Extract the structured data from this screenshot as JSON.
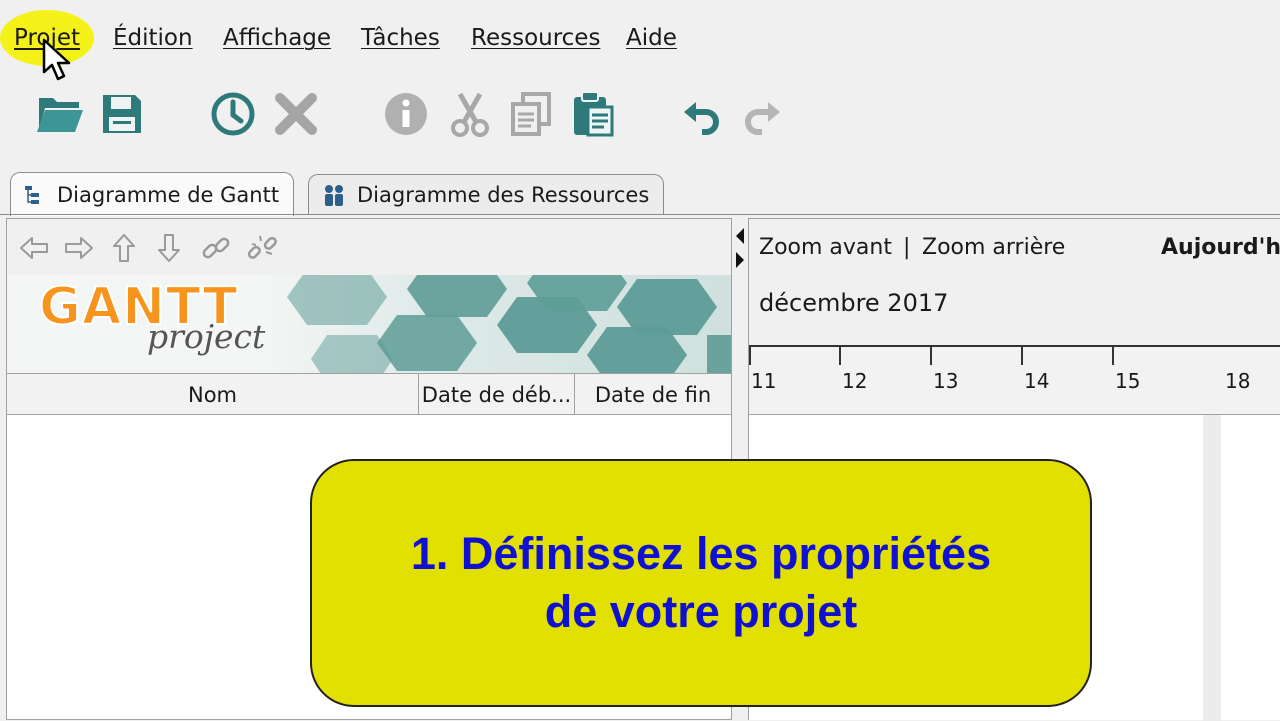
{
  "menu": {
    "items": [
      "Projet",
      "Édition",
      "Affichage",
      "Tâches",
      "Ressources",
      "Aide"
    ],
    "highlight_color": "#f5f21a"
  },
  "toolbar": {
    "icons": [
      "folder-open-icon",
      "save-icon",
      "clock-icon",
      "delete-icon",
      "info-icon",
      "cut-icon",
      "copy-icon",
      "paste-icon",
      "undo-icon",
      "redo-icon"
    ]
  },
  "tabs": {
    "gantt": "Diagramme de Gantt",
    "resources": "Diagramme des Ressources"
  },
  "logo": {
    "word1": "GANTT",
    "word2": "project",
    "color": "#f7941d"
  },
  "table": {
    "columns": [
      "Nom",
      "Date de déb...",
      "Date de fin"
    ]
  },
  "chart": {
    "zoom_in": "Zoom avant",
    "separator": "|",
    "zoom_out": "Zoom arrière",
    "today": "Aujourd'hu",
    "month": "décembre 2017",
    "days": [
      "11",
      "12",
      "13",
      "14",
      "15",
      "18"
    ]
  },
  "callout": {
    "line1": "1. Définissez les propriétés",
    "line2": "de votre projet",
    "bg_color": "#e1e000",
    "text_color": "#1010d0"
  }
}
